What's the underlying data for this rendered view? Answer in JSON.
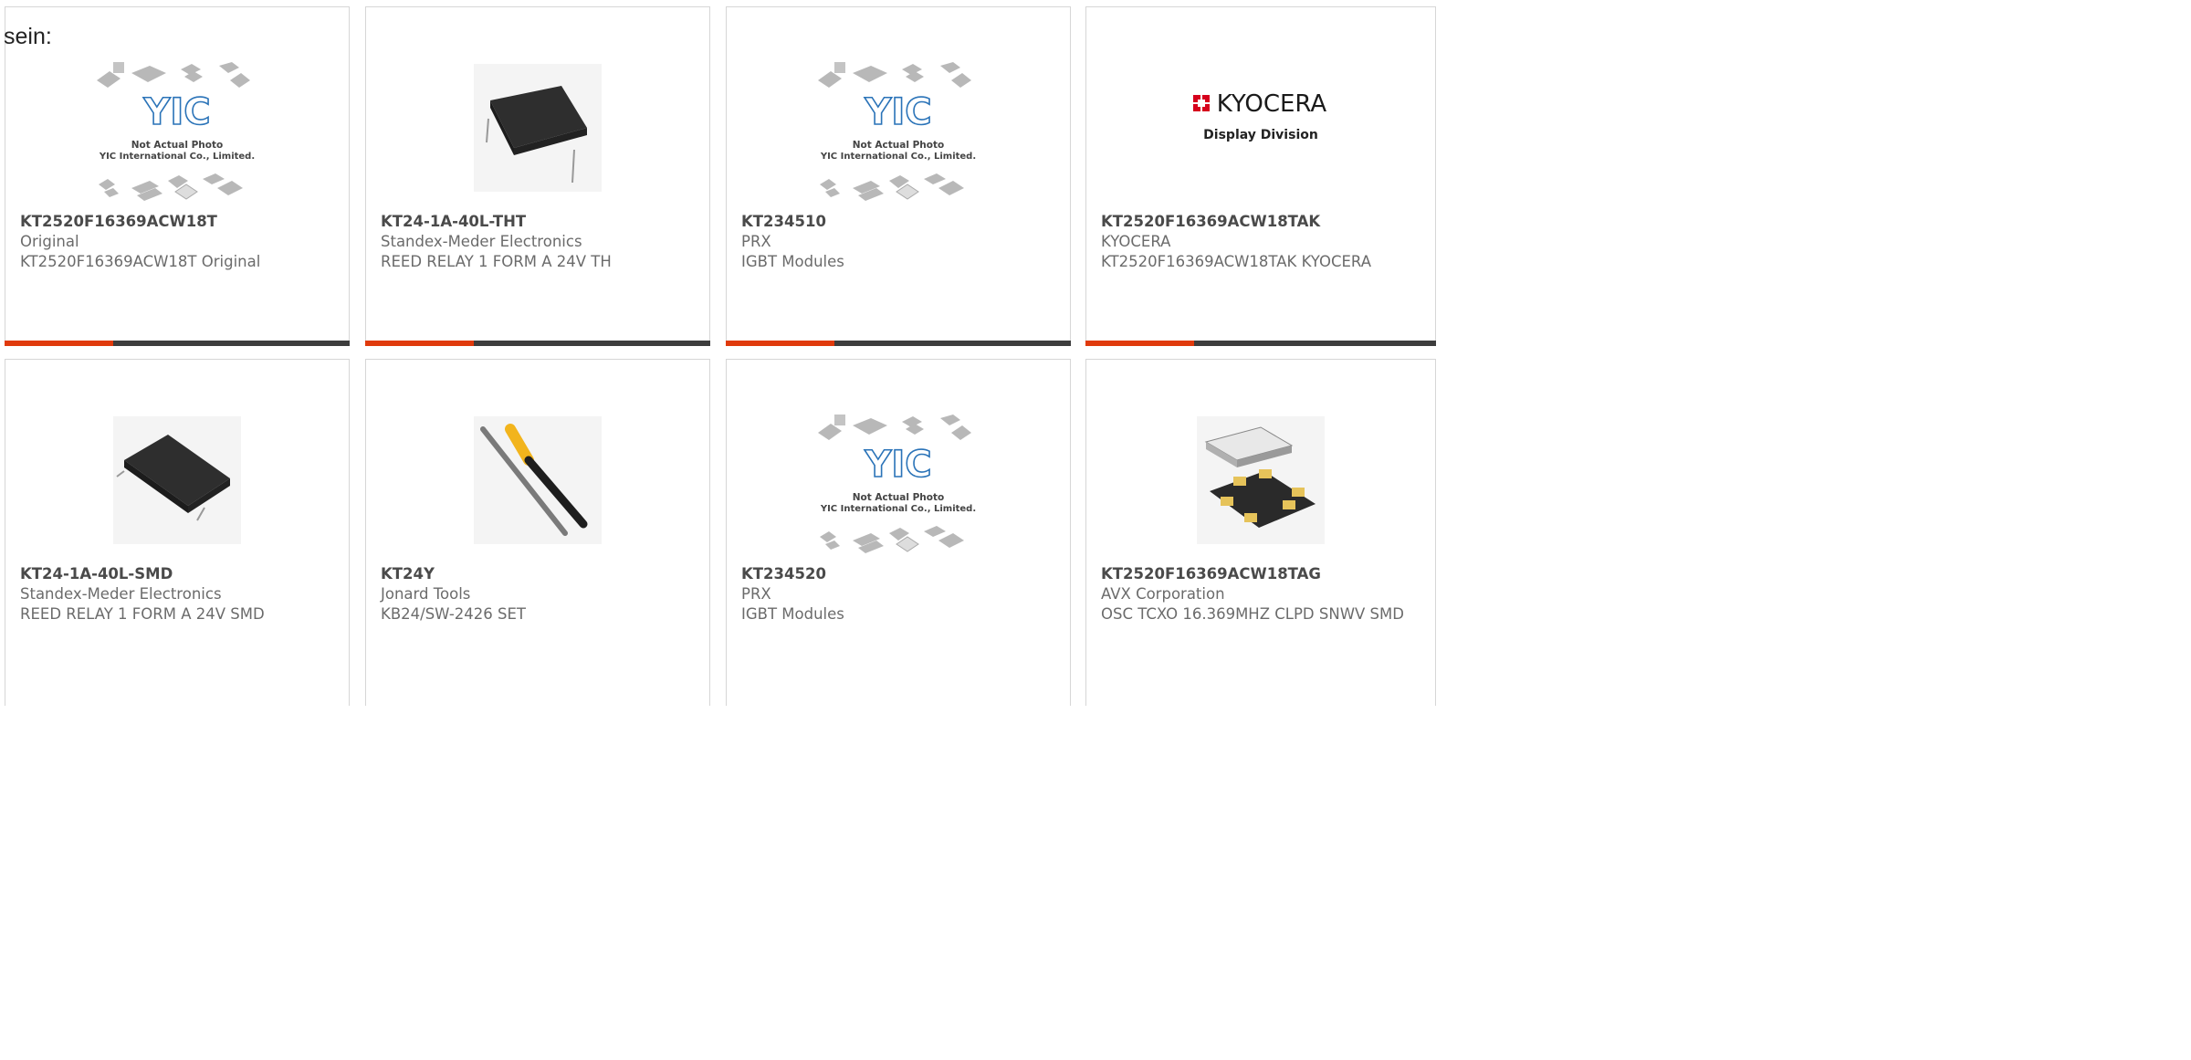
{
  "intro": "sein:",
  "placeholder": {
    "line1": "Not Actual Photo",
    "line2": "YIC International Co., Limited.",
    "logo": "YIC"
  },
  "kyocera": {
    "brand": "KYOCERA",
    "division": "Display Division"
  },
  "accent_colors": {
    "bar_orange": "#e03a0c",
    "bar_dark": "#3d3d3d"
  },
  "products": [
    {
      "part": "KT2520F16369ACW18T",
      "manufacturer": "Original",
      "description": "KT2520F16369ACW18T Original",
      "image": "yic-placeholder"
    },
    {
      "part": "KT24-1A-40L-THT",
      "manufacturer": "Standex-Meder Electronics",
      "description": "REED RELAY 1 FORM A 24V TH",
      "image": "reed-relay-tht"
    },
    {
      "part": "KT234510",
      "manufacturer": "PRX",
      "description": "IGBT Modules",
      "image": "yic-placeholder"
    },
    {
      "part": "KT2520F16369ACW18TAK",
      "manufacturer": "KYOCERA",
      "description": "KT2520F16369ACW18TAK KYOCERA",
      "image": "kyocera-logo"
    },
    {
      "part": "KT24-1A-40L-SMD",
      "manufacturer": "Standex-Meder Electronics",
      "description": "REED RELAY 1 FORM A 24V SMD",
      "image": "reed-relay-smd"
    },
    {
      "part": "KT24Y",
      "manufacturer": "Jonard Tools",
      "description": "KB24/SW-2426 SET",
      "image": "tool-set"
    },
    {
      "part": "KT234520",
      "manufacturer": "PRX",
      "description": "IGBT Modules",
      "image": "yic-placeholder"
    },
    {
      "part": "KT2520F16369ACW18TAG",
      "manufacturer": "AVX Corporation",
      "description": "OSC TCXO 16.369MHZ CLPD SNWV SMD",
      "image": "oscillator-smd"
    }
  ]
}
